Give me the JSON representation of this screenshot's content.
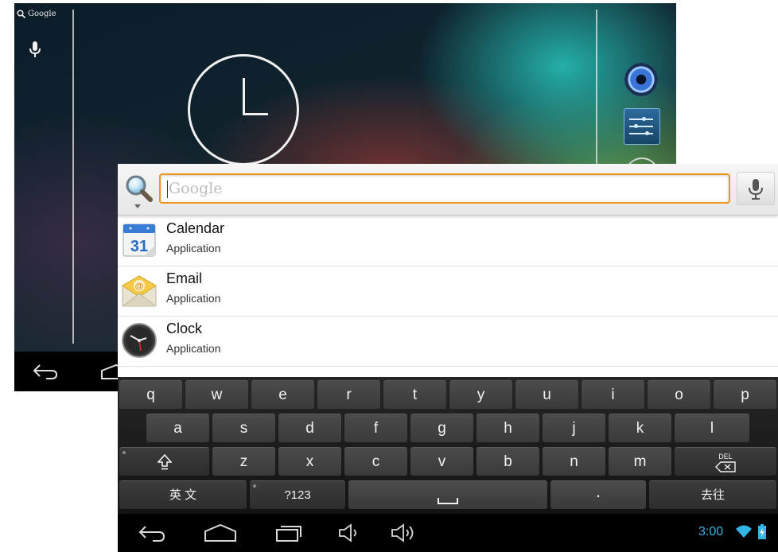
{
  "home_screen": {
    "search_label": "Google"
  },
  "search": {
    "placeholder": "Google"
  },
  "results": [
    {
      "title": "Calendar",
      "subtitle": "Application",
      "icon": "calendar-icon",
      "icon_text": "31"
    },
    {
      "title": "Email",
      "subtitle": "Application",
      "icon": "email-icon",
      "icon_text": "@"
    },
    {
      "title": "Clock",
      "subtitle": "Application",
      "icon": "clock-icon"
    }
  ],
  "keyboard": {
    "row1": [
      "q",
      "w",
      "e",
      "r",
      "t",
      "y",
      "u",
      "i",
      "o",
      "p"
    ],
    "row2": [
      "a",
      "s",
      "d",
      "f",
      "g",
      "h",
      "j",
      "k",
      "l"
    ],
    "row3": [
      "z",
      "x",
      "c",
      "v",
      "b",
      "n",
      "m"
    ],
    "delete_label": "DEL",
    "language_label": "英 文",
    "symbols_label": "?123",
    "period_label": "·",
    "go_label": "去往"
  },
  "status_bar": {
    "time": "3:00",
    "accent": "#33b5e5"
  }
}
